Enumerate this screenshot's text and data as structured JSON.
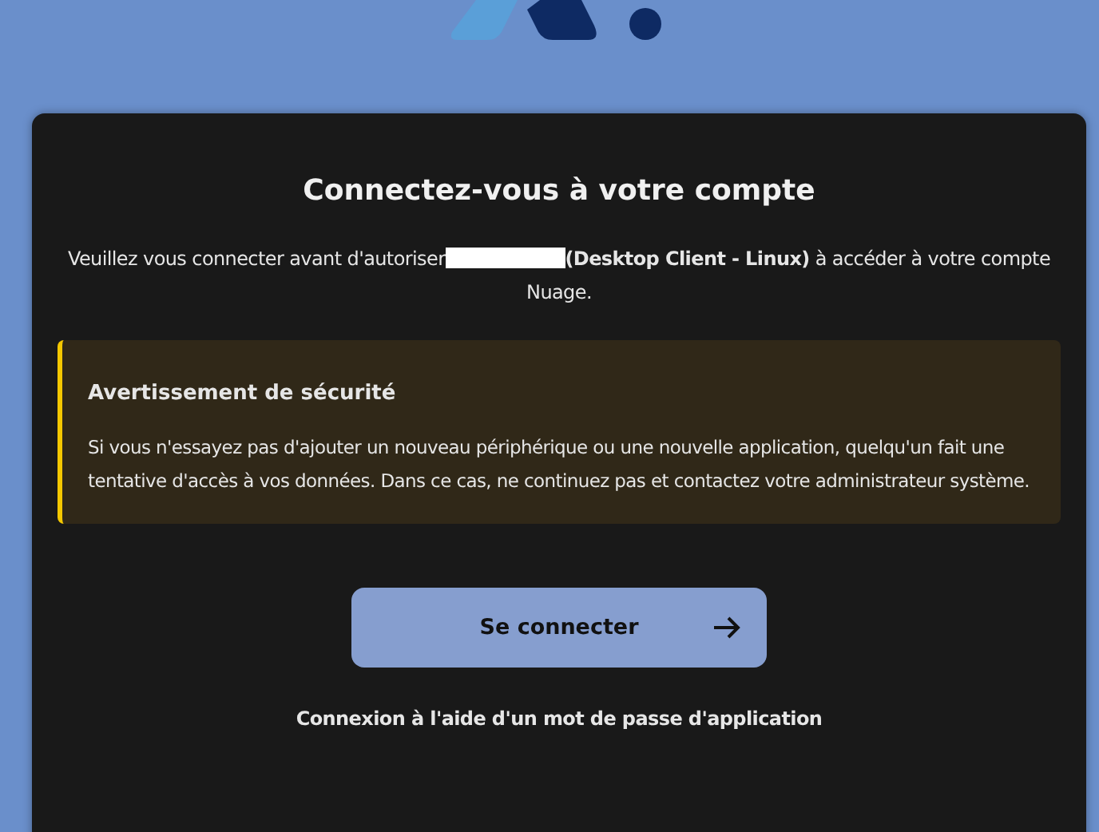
{
  "title": "Connectez-vous à votre compte",
  "intro": {
    "before": "Veuillez vous connecter avant d'autoriser",
    "redacted": true,
    "after": "**(Desktop Client - Linux)** à accéder à votre compte Nuage."
  },
  "warning": {
    "title": "Avertissement de sécurité",
    "text": "Si vous n'essayez pas d'ajouter un nouveau périphérique ou une nouvelle application, quelqu'un fait une tentative d'accès à vos données. Dans ce cas, ne continuez pas et contactez votre administrateur système."
  },
  "login_button": {
    "label": "Se connecter"
  },
  "app_password_link": "Connexion à l'aide d'un mot de passe d'application"
}
